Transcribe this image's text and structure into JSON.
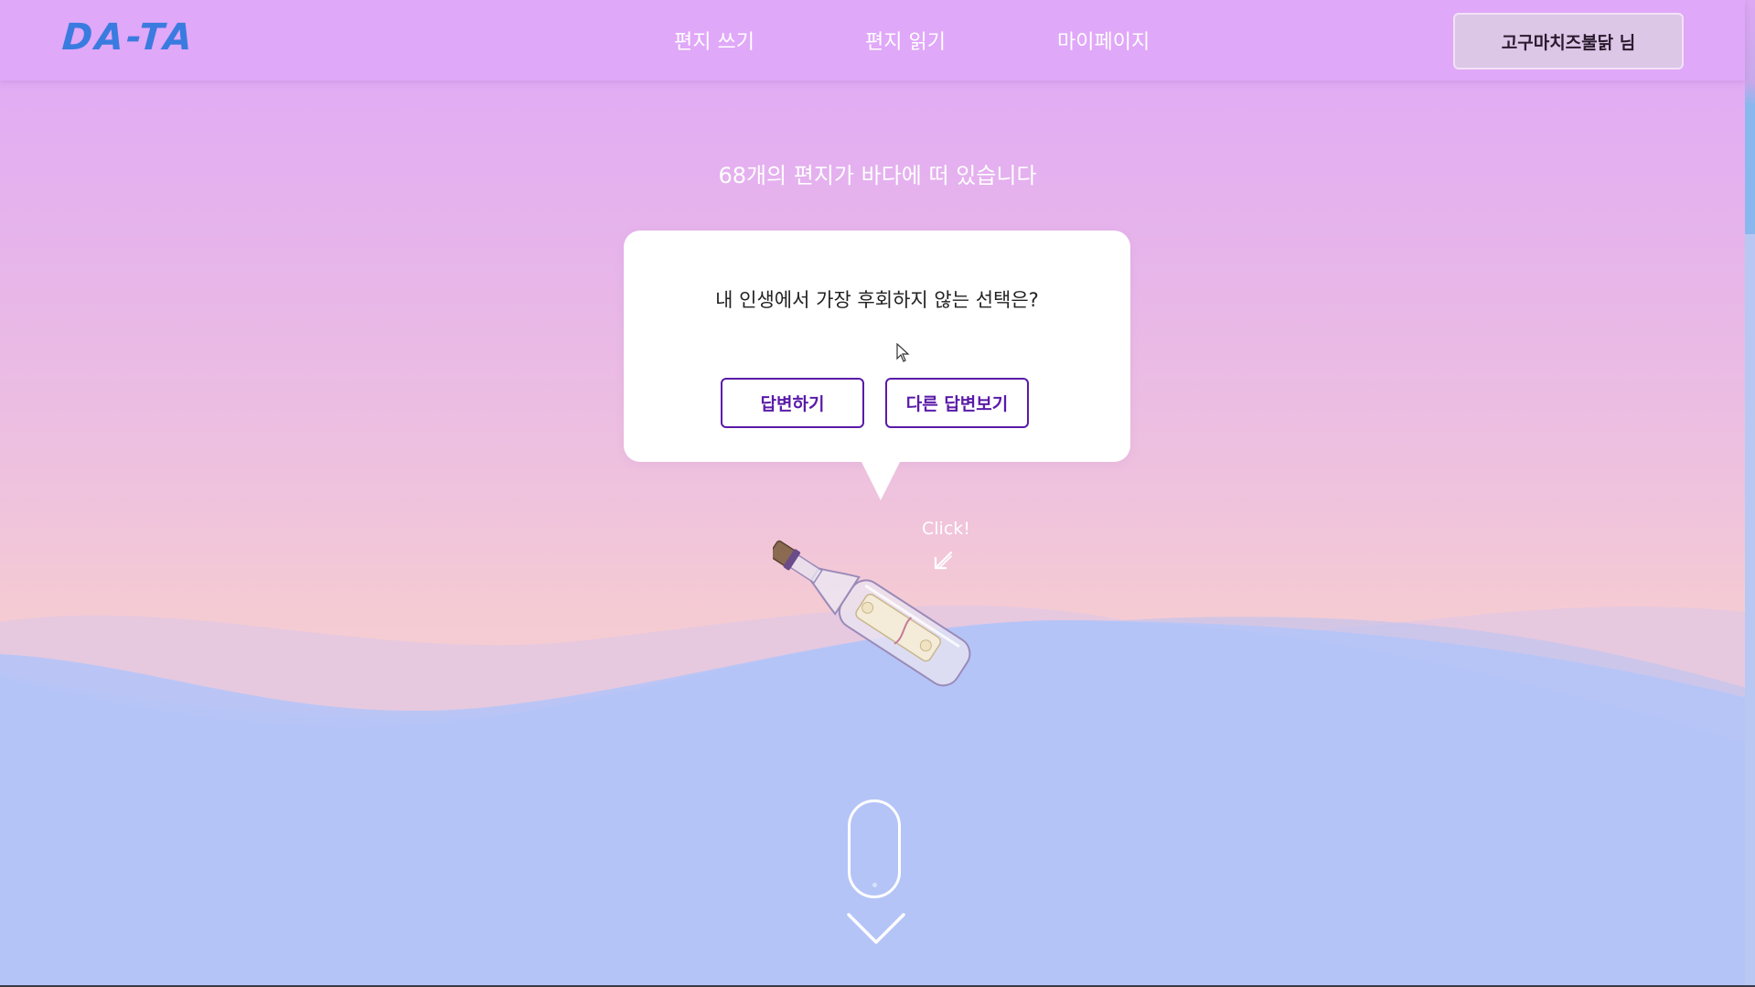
{
  "header": {
    "logo": "DA-TA",
    "nav": {
      "write": "편지 쓰기",
      "read": "편지 읽기",
      "mypage": "마이페이지"
    },
    "user_button": "고구마치즈불닭 님"
  },
  "main": {
    "count_text": "68개의 편지가 바다에 떠 있습니다",
    "bubble": {
      "question": "내 인생에서 가장 후회하지 않는 선택은?",
      "answer_button": "답변하기",
      "others_button": "다른 답변보기"
    },
    "click_hint": "Click!"
  },
  "icons": {
    "cursor": "mouse-pointer-icon",
    "arrow": "arrow-down-left-icon",
    "bottle": "message-bottle-icon",
    "scroll": "scroll-mouse-icon",
    "chevron": "chevron-down-icon"
  },
  "colors": {
    "header_bg": "#e0a8f8",
    "logo": "#3a7be0",
    "sea": "#b5c4f7",
    "button_accent": "#5a1aa8"
  }
}
